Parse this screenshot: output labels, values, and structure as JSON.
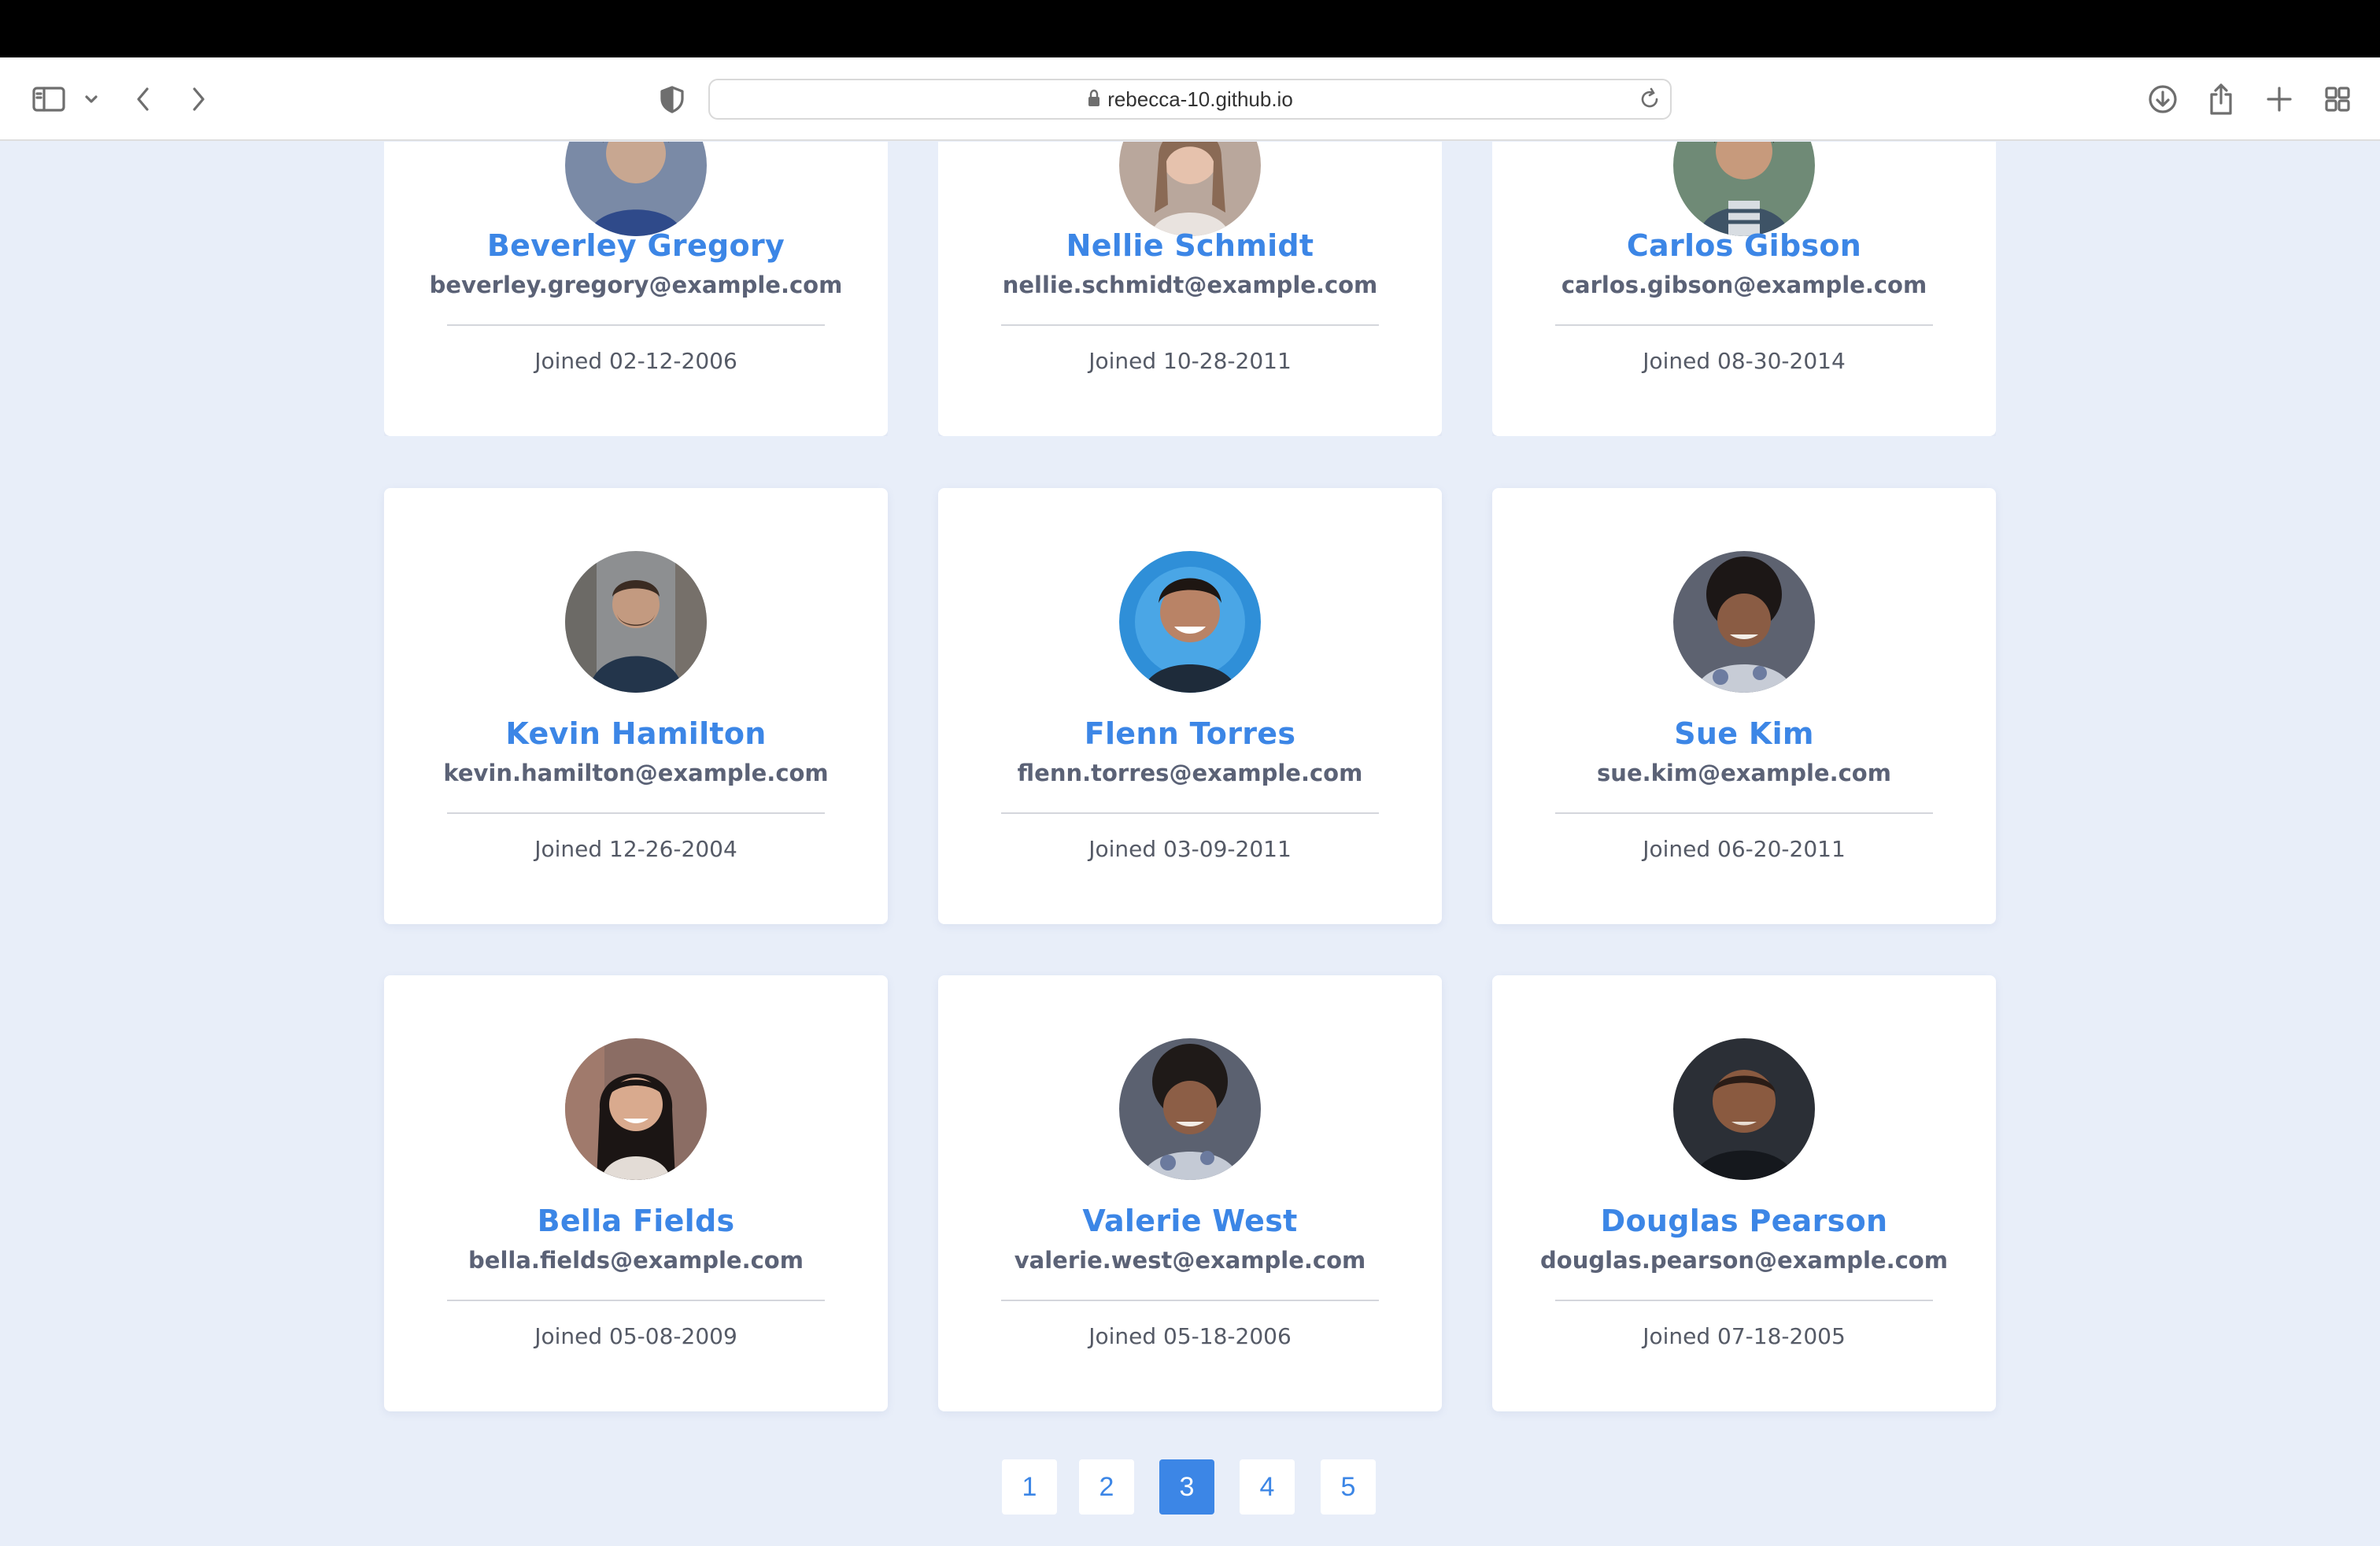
{
  "browser": {
    "url": "rebecca-10.github.io"
  },
  "users": [
    {
      "name": "Beverley Gregory",
      "email": "beverley.gregory@example.com",
      "joined": "Joined 02-12-2006"
    },
    {
      "name": "Nellie Schmidt",
      "email": "nellie.schmidt@example.com",
      "joined": "Joined 10-28-2011"
    },
    {
      "name": "Carlos Gibson",
      "email": "carlos.gibson@example.com",
      "joined": "Joined 08-30-2014"
    },
    {
      "name": "Kevin Hamilton",
      "email": "kevin.hamilton@example.com",
      "joined": "Joined 12-26-2004"
    },
    {
      "name": "Flenn Torres",
      "email": "flenn.torres@example.com",
      "joined": "Joined 03-09-2011"
    },
    {
      "name": "Sue Kim",
      "email": "sue.kim@example.com",
      "joined": "Joined 06-20-2011"
    },
    {
      "name": "Bella Fields",
      "email": "bella.fields@example.com",
      "joined": "Joined 05-08-2009"
    },
    {
      "name": "Valerie West",
      "email": "valerie.west@example.com",
      "joined": "Joined 05-18-2006"
    },
    {
      "name": "Douglas Pearson",
      "email": "douglas.pearson@example.com",
      "joined": "Joined 07-18-2005"
    }
  ],
  "pagination": {
    "pages": [
      "1",
      "2",
      "3",
      "4",
      "5"
    ],
    "current": "3"
  },
  "colors": {
    "background": "#e8eef9",
    "accent": "#3c86e6",
    "card": "#ffffff"
  }
}
